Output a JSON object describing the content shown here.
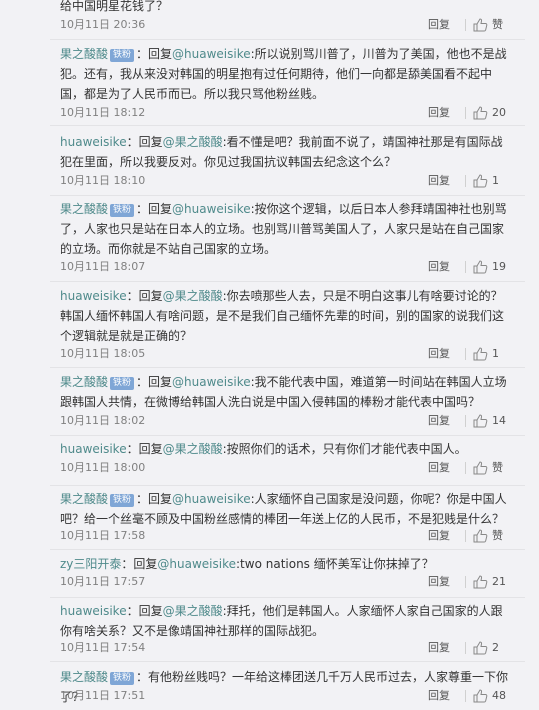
{
  "reply_label": "回复",
  "comments": [
    {
      "prefix": "",
      "user": "",
      "badge": "",
      "mid": "",
      "target": "",
      "text": "给中国明星花钱了？",
      "time": "10月11日 20:36",
      "likes": "赞"
    },
    {
      "prefix": "",
      "user": "果之酸酸",
      "badge": "铁粉",
      "mid": "：回复",
      "target": "@huaweisike",
      "text": ":所以说别骂川普了，川普为了美国，他也不是战犯。还有，我从来没对韩国的明星抱有过任何期待，他们一向都是舔美国看不起中国，都是为了人民币而已。所以我只骂他粉丝贱。",
      "time": "10月11日 18:12",
      "likes": "20"
    },
    {
      "prefix": "",
      "user": "huaweisike",
      "badge": "",
      "mid": "：回复",
      "target": "@果之酸酸",
      "text": ":看不懂是吧？我前面不说了，靖国神社那是有国际战犯在里面，所以我要反对。你见过我国抗议韩国去纪念这个么？",
      "time": "10月11日 18:10",
      "likes": "1"
    },
    {
      "prefix": "",
      "user": "果之酸酸",
      "badge": "铁粉",
      "mid": "：回复",
      "target": "@huaweisike",
      "text": ":按你这个逻辑，以后日本人参拜靖国神社也别骂了，人家也只是站在日本人的立场。也别骂川普骂美国人了，人家只是站在自己国家的立场。而你就是不站自己国家的立场。",
      "time": "10月11日 18:07",
      "likes": "19"
    },
    {
      "prefix": "",
      "user": "huaweisike",
      "badge": "",
      "mid": "：回复",
      "target": "@果之酸酸",
      "text": ":你去喷那些人去，只是不明白这事儿有啥要讨论的？韩国人缅怀韩国人有啥问题，是不是我们自己缅怀先辈的时间，别的国家的说我们这个逻辑就是就是正确的？",
      "time": "10月11日 18:05",
      "likes": "1"
    },
    {
      "prefix": "",
      "user": "果之酸酸",
      "badge": "铁粉",
      "mid": "：回复",
      "target": "@huaweisike",
      "text": ":我不能代表中国，难道第一时间站在韩国人立场跟韩国人共情，在微博给韩国人洗白说是中国入侵韩国的棒粉才能代表中国吗？",
      "time": "10月11日 18:02",
      "likes": "14"
    },
    {
      "prefix": "",
      "user": "huaweisike",
      "badge": "",
      "mid": "：回复",
      "target": "@果之酸酸",
      "text": ":按照你们的话术，只有你们才能代表中国人。",
      "time": "10月11日 18:00",
      "likes": "赞"
    },
    {
      "prefix": "",
      "user": "果之酸酸",
      "badge": "铁粉",
      "mid": "：回复",
      "target": "@huaweisike",
      "text": ":人家缅怀自己国家是没问题，你呢？你是中国人吧？给一个丝毫不顾及中国粉丝感情的棒团一年送上亿的人民币，不是犯贱是什么？",
      "time": "10月11日 17:58",
      "likes": "赞"
    },
    {
      "prefix": "",
      "user": "zy三阳开泰",
      "badge": "",
      "mid": "：回复",
      "target": "@huaweisike",
      "text": ":two nations 缅怀美军让你抹掉了？",
      "time": "10月11日 17:57",
      "likes": "21"
    },
    {
      "prefix": "",
      "user": "huaweisike",
      "badge": "",
      "mid": "：回复",
      "target": "@果之酸酸",
      "text": ":拜托，他们是韩国人。人家缅怀人家自己国家的人跟你有啥关系？又不是像靖国神社那样的国际战犯。",
      "time": "10月11日 17:54",
      "likes": "2"
    },
    {
      "prefix": "",
      "user": "果之酸酸",
      "badge": "铁粉",
      "mid": "：",
      "target": "",
      "text": "有他粉丝贱吗？一年给这棒团送几千万人民币过去，人家尊重一下你了？",
      "time": "10月11日 17:51",
      "likes": "48"
    }
  ]
}
